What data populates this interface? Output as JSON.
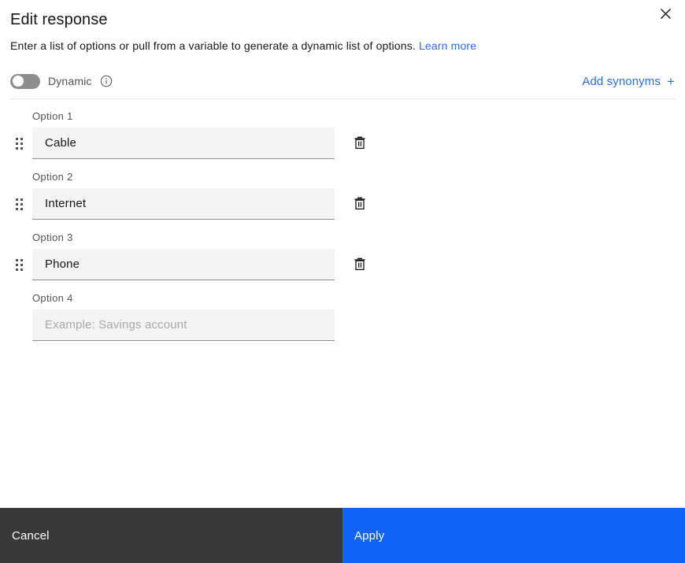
{
  "dialog": {
    "title": "Edit response",
    "description": "Enter a list of options or pull from a variable to generate a dynamic list of options.",
    "learn_more_label": "Learn more",
    "close_icon": "close-icon"
  },
  "toolbar": {
    "toggle": {
      "label": "Dynamic",
      "state": "off",
      "info_icon": "info-icon"
    },
    "add_synonyms": {
      "label": "Add synonyms",
      "plus_glyph": "+"
    }
  },
  "options": [
    {
      "label": "Option 1",
      "value": "Cable",
      "placeholder": "Example: Savings account",
      "has_drag_handle": true,
      "has_delete": true
    },
    {
      "label": "Option 2",
      "value": "Internet",
      "placeholder": "Example: Savings account",
      "has_drag_handle": true,
      "has_delete": true
    },
    {
      "label": "Option 3",
      "value": "Phone",
      "placeholder": "Example: Savings account",
      "has_drag_handle": true,
      "has_delete": true
    },
    {
      "label": "Option 4",
      "value": "",
      "placeholder": "Example: Savings account",
      "has_drag_handle": false,
      "has_delete": false
    }
  ],
  "footer": {
    "cancel_label": "Cancel",
    "apply_label": "Apply"
  },
  "colors": {
    "accent_blue": "#2a6bf2",
    "apply_blue": "#1064fa",
    "cancel_gray": "#393939",
    "field_bg": "#f4f4f4",
    "field_underline": "#8d8d8d",
    "toggle_off": "#8d8d8d"
  }
}
